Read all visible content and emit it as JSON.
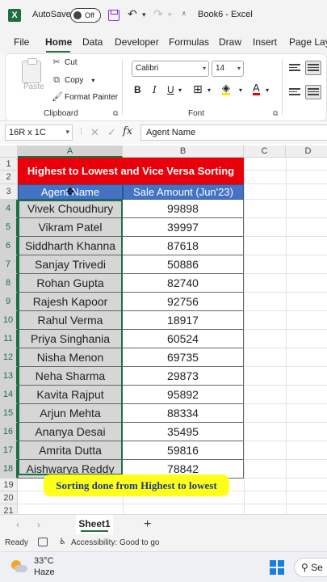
{
  "titlebar": {
    "app_logo": "X",
    "autosave_label": "AutoSave",
    "autosave_state": "Off",
    "doc_title": "Book6  -  Excel"
  },
  "menu": [
    "File",
    "Home",
    "Data",
    "Developer",
    "Formulas",
    "Draw",
    "Insert",
    "Page Layo"
  ],
  "ribbon": {
    "paste": "Paste",
    "cut": "Cut",
    "copy": "Copy",
    "format_painter": "Format Painter",
    "clipboard_label": "Clipboard",
    "font_name": "Calibri",
    "font_size": "14",
    "font_label": "Font",
    "bold": "B",
    "italic": "I",
    "underline": "U"
  },
  "formula_bar": {
    "namebox": "16R x 1C",
    "fx": "fx",
    "content": "Agent Name"
  },
  "columns": [
    "A",
    "B",
    "C",
    "D"
  ],
  "rows": [
    "1",
    "2",
    "3",
    "4",
    "5",
    "6",
    "7",
    "8",
    "9",
    "10",
    "11",
    "12",
    "13",
    "14",
    "15",
    "16",
    "17",
    "18",
    "19",
    "20",
    "21"
  ],
  "table": {
    "title": "Highest to Lowest and Vice Versa Sorting",
    "headers": [
      "Agent Name",
      "Sale Amount (Jun'23)"
    ],
    "data": [
      [
        "Vivek Choudhury",
        "99898"
      ],
      [
        "Vikram Patel",
        "39997"
      ],
      [
        "Siddharth Khanna",
        "87618"
      ],
      [
        "Sanjay Trivedi",
        "50886"
      ],
      [
        "Rohan Gupta",
        "82740"
      ],
      [
        "Rajesh Kapoor",
        "92756"
      ],
      [
        "Rahul Verma",
        "18917"
      ],
      [
        "Priya Singhania",
        "60524"
      ],
      [
        "Nisha Menon",
        "69735"
      ],
      [
        "Neha Sharma",
        "29873"
      ],
      [
        "Kavita Rajput",
        "95892"
      ],
      [
        "Arjun Mehta",
        "88334"
      ],
      [
        "Ananya Desai",
        "35495"
      ],
      [
        "Amrita Dutta",
        "59816"
      ],
      [
        "Aishwarya Reddy",
        "78842"
      ]
    ]
  },
  "caption": "Sorting done from Highest to lowest",
  "sheet_tab": "Sheet1",
  "status": {
    "ready": "Ready",
    "accessibility": "Accessibility: Good to go"
  },
  "taskbar": {
    "temp": "33°C",
    "weather": "Haze",
    "search": "Se"
  },
  "colors": {
    "excel_green": "#1d6f42",
    "title_red": "#e8000a",
    "header_blue": "#4472c4",
    "name_gray": "#d6d6d6",
    "caption_yellow": "#ffff1a"
  }
}
